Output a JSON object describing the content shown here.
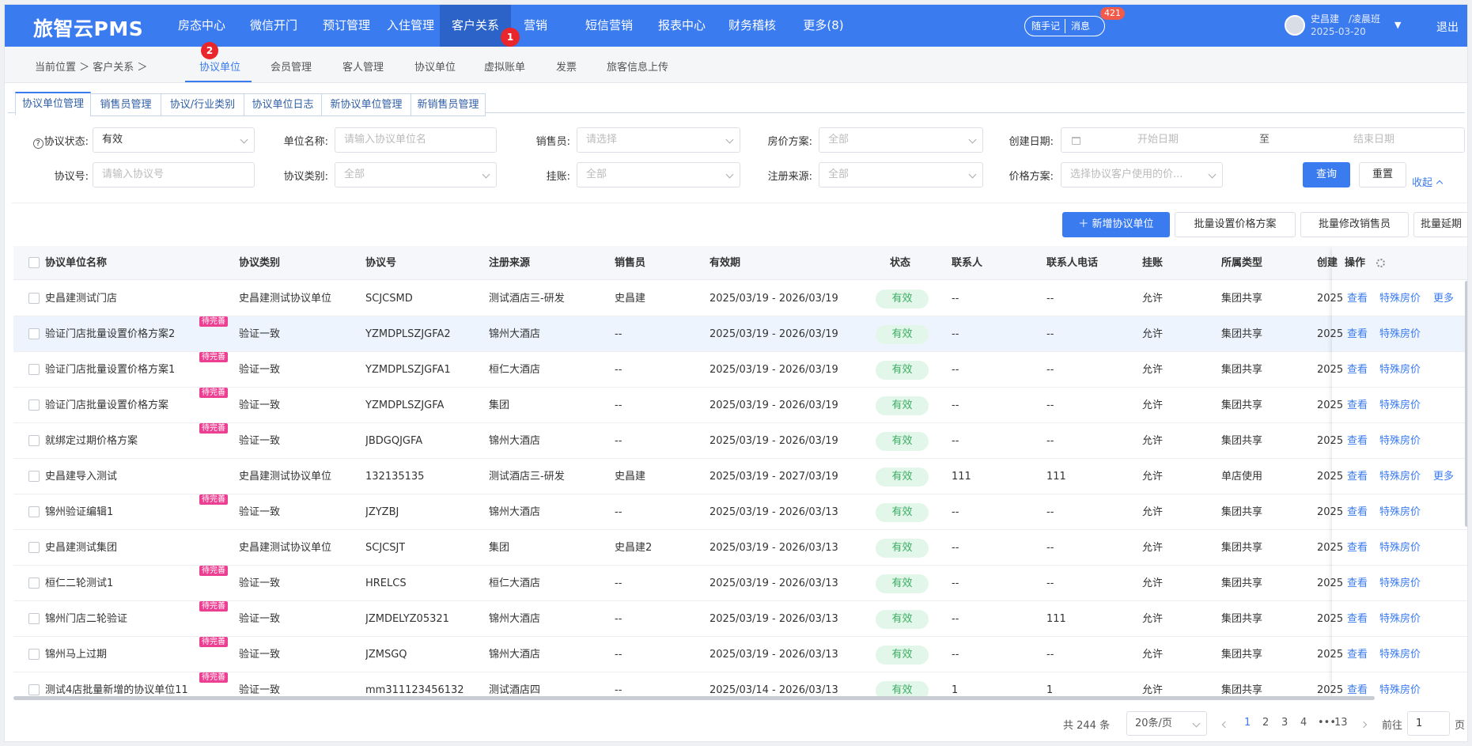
{
  "app": {
    "logo": "旅智云PMS",
    "nav": [
      {
        "label": "房态中心",
        "active": false
      },
      {
        "label": "微信开门",
        "active": false
      },
      {
        "label": "预订管理",
        "active": false
      },
      {
        "label": "入住管理",
        "active": false
      },
      {
        "label": "客户关系",
        "active": true
      },
      {
        "label": "营销",
        "active": false
      },
      {
        "label": "短信营销",
        "active": false
      },
      {
        "label": "报表中心",
        "active": false
      },
      {
        "label": "财务稽核",
        "active": false
      },
      {
        "label": "更多(8)",
        "active": false
      }
    ],
    "nav_badge": "1",
    "quick_note": "随手记",
    "messages": "消息",
    "message_count": "421",
    "user_name": "史昌建　/凌晨班",
    "user_date": "2025-03-20",
    "logout": "退出"
  },
  "subnav": {
    "breadcrumb": "当前位置 ＞ 客户关系 ＞",
    "tabs": [
      "协议单位",
      "会员管理",
      "客人管理",
      "协议单位",
      "虚拟账单",
      "发票",
      "旅客信息上传"
    ],
    "active_tab": 0,
    "tab_badge": "2"
  },
  "module_tabs": [
    "协议单位管理",
    "销售员管理",
    "协议/行业类别",
    "协议单位日志",
    "新协议单位管理",
    "新销售员管理"
  ],
  "filters": {
    "status_label": "协议状态:",
    "status_value": "有效",
    "name_label": "单位名称:",
    "name_placeholder": "请输入协议单位名",
    "sales_label": "销售员:",
    "sales_placeholder": "请选择",
    "room_plan_label": "房价方案:",
    "room_plan_value": "全部",
    "created_label": "创建日期:",
    "start_placeholder": "开始日期",
    "date_to": "至",
    "end_placeholder": "结束日期",
    "code_label": "协议号:",
    "code_placeholder": "请输入协议号",
    "category_label": "协议类别:",
    "category_value": "全部",
    "credit_label": "挂账:",
    "credit_value": "全部",
    "source_label": "注册来源:",
    "source_value": "全部",
    "price_plan_label": "价格方案:",
    "price_plan_placeholder": "选择协议客户使用的价...",
    "search_btn": "查询",
    "reset_btn": "重置",
    "collapse": "收起"
  },
  "actions": {
    "add": "＋ 新增协议单位",
    "batch_price": "批量设置价格方案",
    "batch_sales": "批量修改销售员",
    "batch_extend": "批量延期"
  },
  "table": {
    "columns": [
      "协议单位名称",
      "协议类别",
      "协议号",
      "注册来源",
      "销售员",
      "有效期",
      "状态",
      "联系人",
      "联系人电话",
      "挂账",
      "所属类型",
      "创建",
      "操作"
    ],
    "pending_tag": "待完善",
    "op_view": "查看",
    "op_special": "特殊房价",
    "op_more": "更多",
    "rows": [
      {
        "name": "史昌建测试门店",
        "category": "史昌建测试协议单位",
        "code": "SCJCSMD",
        "source": "测试酒店三-研发",
        "sales": "史昌建",
        "period": "2025/03/19 - 2026/03/19",
        "status": "有效",
        "contact": "--",
        "phone": "--",
        "credit": "允许",
        "type": "集团共享",
        "created": "2025",
        "pending": false,
        "more": true
      },
      {
        "name": "验证门店批量设置价格方案2",
        "category": "验证一致",
        "code": "YZMDPLSZJGFA2",
        "source": "锦州大酒店",
        "sales": "--",
        "period": "2025/03/19 - 2026/03/19",
        "status": "有效",
        "contact": "--",
        "phone": "--",
        "credit": "允许",
        "type": "集团共享",
        "created": "2025",
        "pending": true,
        "more": false
      },
      {
        "name": "验证门店批量设置价格方案1",
        "category": "验证一致",
        "code": "YZMDPLSZJGFA1",
        "source": "桓仁大酒店",
        "sales": "--",
        "period": "2025/03/19 - 2026/03/19",
        "status": "有效",
        "contact": "--",
        "phone": "--",
        "credit": "允许",
        "type": "集团共享",
        "created": "2025",
        "pending": true,
        "more": false
      },
      {
        "name": "验证门店批量设置价格方案",
        "category": "验证一致",
        "code": "YZMDPLSZJGFA",
        "source": "集团",
        "sales": "--",
        "period": "2025/03/19 - 2026/03/19",
        "status": "有效",
        "contact": "--",
        "phone": "--",
        "credit": "允许",
        "type": "集团共享",
        "created": "2025",
        "pending": true,
        "more": false
      },
      {
        "name": "就绑定过期价格方案",
        "category": "验证一致",
        "code": "JBDGQJGFA",
        "source": "锦州大酒店",
        "sales": "--",
        "period": "2025/03/19 - 2026/03/19",
        "status": "有效",
        "contact": "--",
        "phone": "--",
        "credit": "允许",
        "type": "集团共享",
        "created": "2025",
        "pending": true,
        "more": false
      },
      {
        "name": "史昌建导入测试",
        "category": "史昌建测试协议单位",
        "code": "132135135",
        "source": "测试酒店三-研发",
        "sales": "史昌建",
        "period": "2025/03/19 - 2027/03/19",
        "status": "有效",
        "contact": "111",
        "phone": "111",
        "credit": "允许",
        "type": "单店使用",
        "created": "2025",
        "pending": false,
        "more": true
      },
      {
        "name": "锦州验证编辑1",
        "category": "验证一致",
        "code": "JZYZBJ",
        "source": "锦州大酒店",
        "sales": "--",
        "period": "2025/03/19 - 2026/03/13",
        "status": "有效",
        "contact": "--",
        "phone": "--",
        "credit": "允许",
        "type": "集团共享",
        "created": "2025",
        "pending": true,
        "more": false
      },
      {
        "name": "史昌建测试集团",
        "category": "史昌建测试协议单位",
        "code": "SCJCSJT",
        "source": "集团",
        "sales": "史昌建2",
        "period": "2025/03/19 - 2026/03/13",
        "status": "有效",
        "contact": "--",
        "phone": "--",
        "credit": "允许",
        "type": "集团共享",
        "created": "2025",
        "pending": false,
        "more": false
      },
      {
        "name": "桓仁二轮测试1",
        "category": "验证一致",
        "code": "HRELCS",
        "source": "桓仁大酒店",
        "sales": "--",
        "period": "2025/03/19 - 2026/03/13",
        "status": "有效",
        "contact": "--",
        "phone": "--",
        "credit": "允许",
        "type": "集团共享",
        "created": "2025",
        "pending": true,
        "more": false
      },
      {
        "name": "锦州门店二轮验证",
        "category": "验证一致",
        "code": "JZMDELYZ05321",
        "source": "锦州大酒店",
        "sales": "--",
        "period": "2025/03/19 - 2026/03/13",
        "status": "有效",
        "contact": "--",
        "phone": "111",
        "credit": "允许",
        "type": "集团共享",
        "created": "2025",
        "pending": true,
        "more": false
      },
      {
        "name": "锦州马上过期",
        "category": "验证一致",
        "code": "JZMSGQ",
        "source": "锦州大酒店",
        "sales": "--",
        "period": "2025/03/19 - 2026/03/13",
        "status": "有效",
        "contact": "--",
        "phone": "--",
        "credit": "允许",
        "type": "集团共享",
        "created": "2025",
        "pending": true,
        "more": false
      },
      {
        "name": "测试4店批量新增的协议单位11",
        "category": "验证一致",
        "code": "mm311123456132",
        "source": "测试酒店四",
        "sales": "--",
        "period": "2025/03/14 - 2026/03/13",
        "status": "有效",
        "contact": "1",
        "phone": "1",
        "credit": "允许",
        "type": "集团共享",
        "created": "2025",
        "pending": true,
        "more": false
      }
    ]
  },
  "pager": {
    "total": "共 244 条",
    "page_size": "20条/页",
    "pages": [
      "1",
      "2",
      "3",
      "4",
      "•••",
      "13"
    ],
    "current": "1",
    "goto_label": "前往",
    "goto_value": "1",
    "goto_unit": "页"
  }
}
